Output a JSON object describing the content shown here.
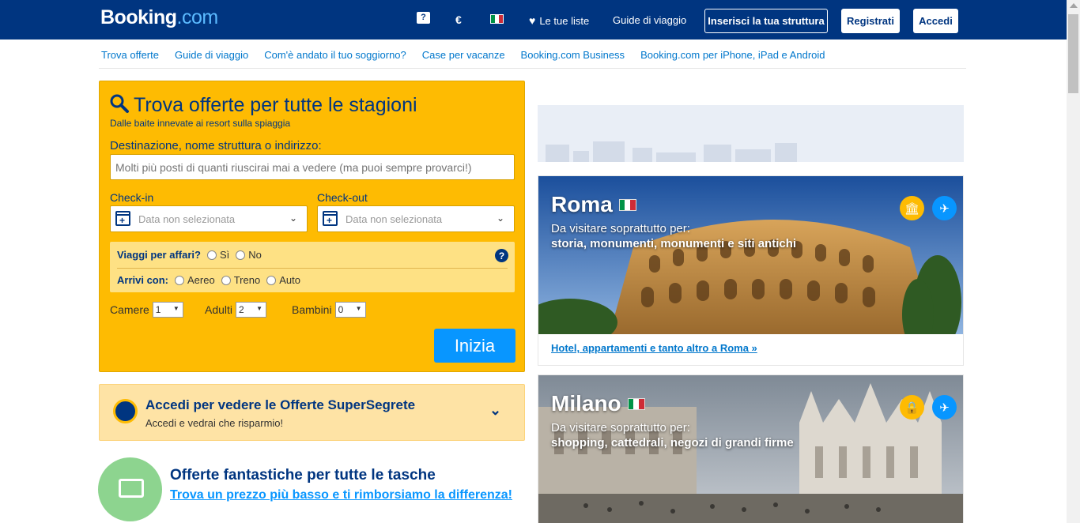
{
  "header": {
    "logo_main": "Booking",
    "logo_suffix": ".com",
    "help_icon": "speech-question-icon",
    "currency": "€",
    "language_flag": "italian-flag-icon",
    "lists_label": "Le tue liste",
    "guides_label": "Guide di viaggio",
    "property_button": "Inserisci la tua struttura",
    "register_button": "Registrati",
    "login_button": "Accedi"
  },
  "subnav": {
    "items": [
      "Trova offerte",
      "Guide di viaggio",
      "Com'è andato il tuo soggiorno?",
      "Case per vacanze",
      "Booking.com Business",
      "Booking.com per iPhone, iPad e Android"
    ]
  },
  "search": {
    "title": "Trova offerte per tutte le stagioni",
    "subtitle": "Dalle baite innevate ai resort sulla spiaggia",
    "destination_label": "Destinazione, nome struttura o indirizzo:",
    "destination_placeholder": "Molti più posti di quanti riuscirai mai a vedere (ma puoi sempre provarci!)",
    "checkin_label": "Check-in",
    "checkout_label": "Check-out",
    "checkin_value": "Data non selezionata",
    "checkout_value": "Data non selezionata",
    "business_label": "Viaggi per affari?",
    "business_yes": "Sì",
    "business_no": "No",
    "arrivals_label": "Arrivi con:",
    "arrival_plane": "Aereo",
    "arrival_train": "Treno",
    "arrival_car": "Auto",
    "rooms_label": "Camere",
    "rooms_value": "1",
    "adults_label": "Adulti",
    "adults_value": "2",
    "children_label": "Bambini",
    "children_value": "0",
    "submit_label": "Inizia"
  },
  "secret_deals": {
    "title": "Accedi per vedere le Offerte SuperSegrete",
    "subtitle": "Accedi e vedrai che risparmio!"
  },
  "deals": {
    "title": "Offerte fantastiche per tutte le tasche",
    "link": "Trova un prezzo più basso e ti rimborsiamo la differenza!"
  },
  "cards": [
    {
      "city": "Roma",
      "visit_label": "Da visitare soprattutto per:",
      "categories": "storia, monumenti, monumenti e siti antichi",
      "link": "Hotel, appartamenti e tanto altro a Roma »",
      "icon1": "museum-icon",
      "icon2": "airplane-icon"
    },
    {
      "city": "Milano",
      "visit_label": "Da visitare soprattutto per:",
      "categories": "shopping, cattedrali, negozi di grandi firme",
      "icon1": "shopping-bag-icon",
      "icon2": "airplane-icon"
    }
  ],
  "colors": {
    "brand_blue": "#003580",
    "accent_yellow": "#febb02",
    "button_blue": "#0896ff"
  }
}
